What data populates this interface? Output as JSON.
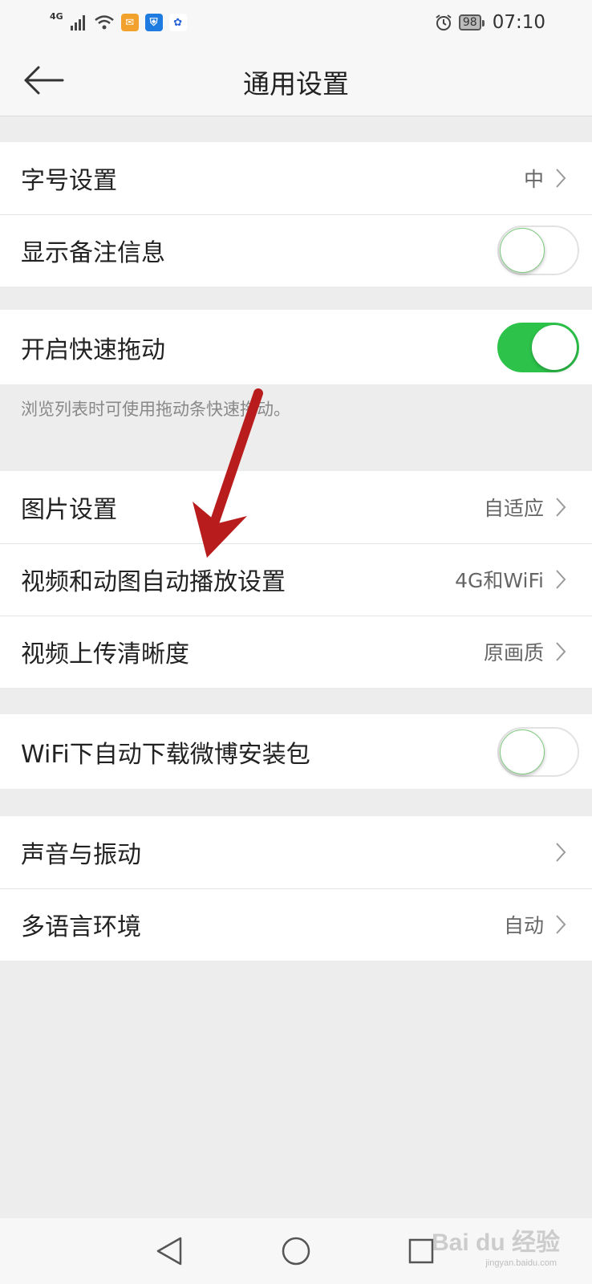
{
  "status_bar": {
    "network": "4G",
    "battery": "98",
    "time": "07:10"
  },
  "header": {
    "title": "通用设置"
  },
  "settings": {
    "font_size": {
      "label": "字号设置",
      "value": "中"
    },
    "show_remark": {
      "label": "显示备注信息",
      "enabled": false
    },
    "quick_drag": {
      "label": "开启快速拖动",
      "enabled": true,
      "hint": "浏览列表时可使用拖动条快速拖动。"
    },
    "image": {
      "label": "图片设置",
      "value": "自适应"
    },
    "video_autoplay": {
      "label": "视频和动图自动播放设置",
      "value": "4G和WiFi"
    },
    "video_upload": {
      "label": "视频上传清晰度",
      "value": "原画质"
    },
    "wifi_download": {
      "label": "WiFi下自动下载微博安装包",
      "enabled": false
    },
    "sound": {
      "label": "声音与振动"
    },
    "language": {
      "label": "多语言环境",
      "value": "自动"
    }
  },
  "colors": {
    "toggle_on": "#2dc34a",
    "annotation_arrow": "#b81c1c"
  },
  "watermark": {
    "text": "Bai du 经验",
    "sub": "jingyan.baidu.com"
  }
}
